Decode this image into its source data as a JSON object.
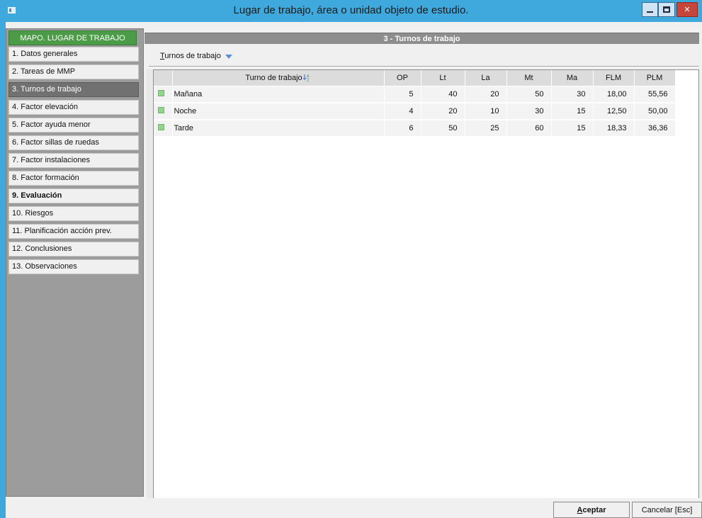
{
  "window": {
    "title": "Lugar de trabajo, área o unidad objeto de estudio."
  },
  "sidebar": {
    "header": "MAPO. LUGAR DE TRABAJO",
    "items": [
      {
        "label": "1. Datos generales"
      },
      {
        "label": "2. Tareas de MMP"
      },
      {
        "label": "3. Turnos de trabajo",
        "active": true
      },
      {
        "label": "4. Factor elevación"
      },
      {
        "label": "5. Factor ayuda menor"
      },
      {
        "label": "6. Factor sillas de ruedas"
      },
      {
        "label": "7. Factor instalaciones"
      },
      {
        "label": "8. Factor formación"
      },
      {
        "label": "9. Evaluación",
        "bold": true
      },
      {
        "label": "10. Riesgos"
      },
      {
        "label": "11. Planificación acción prev."
      },
      {
        "label": "12. Conclusiones"
      },
      {
        "label": "13. Observaciones"
      }
    ]
  },
  "main": {
    "section_title": "3 - Turnos de trabajo",
    "dropdown": {
      "first_letter": "T",
      "rest": "urnos de trabajo"
    },
    "grid": {
      "headers": [
        "Turno de trabajo",
        "OP",
        "Lt",
        "La",
        "Mt",
        "Ma",
        "FLM",
        "PLM"
      ],
      "rows": [
        {
          "turno": "Mañana",
          "op": "5",
          "lt": "40",
          "la": "20",
          "mt": "50",
          "ma": "30",
          "flm": "18,00",
          "plm": "55,56"
        },
        {
          "turno": "Noche",
          "op": "4",
          "lt": "20",
          "la": "10",
          "mt": "30",
          "ma": "15",
          "flm": "12,50",
          "plm": "50,00"
        },
        {
          "turno": "Tarde",
          "op": "6",
          "lt": "50",
          "la": "25",
          "mt": "60",
          "ma": "15",
          "flm": "18,33",
          "plm": "36,36"
        }
      ]
    }
  },
  "footer": {
    "accept_first": "A",
    "accept_rest": "ceptar",
    "cancel_label": "Cancelar [Esc]"
  },
  "colors": {
    "titlebar": "#3fa9dd",
    "sidebar_header": "#4c9b47",
    "active_item": "#717171",
    "row_marker": "#8fd58a"
  }
}
